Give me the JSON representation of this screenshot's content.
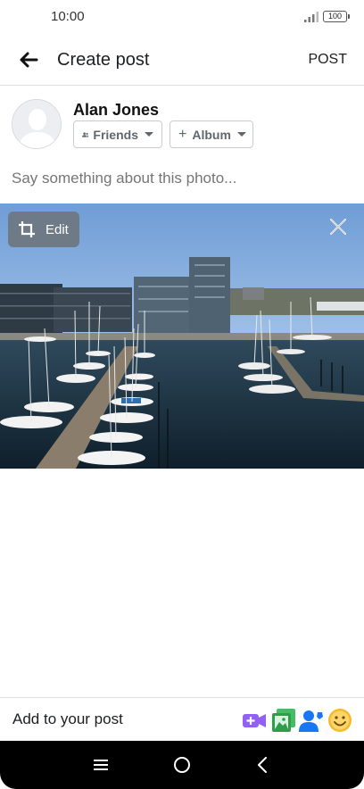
{
  "status_bar": {
    "time": "10:00",
    "battery": "100"
  },
  "header": {
    "title": "Create post",
    "post_label": "POST"
  },
  "author": {
    "name": "Alan Jones",
    "audience_label": "Friends",
    "album_label": "Album"
  },
  "composer": {
    "placeholder": "Say something about this photo..."
  },
  "photo": {
    "edit_label": "Edit"
  },
  "add_to_post": {
    "label": "Add to your post",
    "icons": [
      "video-plus-icon",
      "photo-icon",
      "tag-people-icon",
      "feeling-icon"
    ]
  },
  "colors": {
    "video": "#9360f7",
    "photo": "#45bd62",
    "tag": "#1877f2",
    "feeling": "#f7b928"
  }
}
